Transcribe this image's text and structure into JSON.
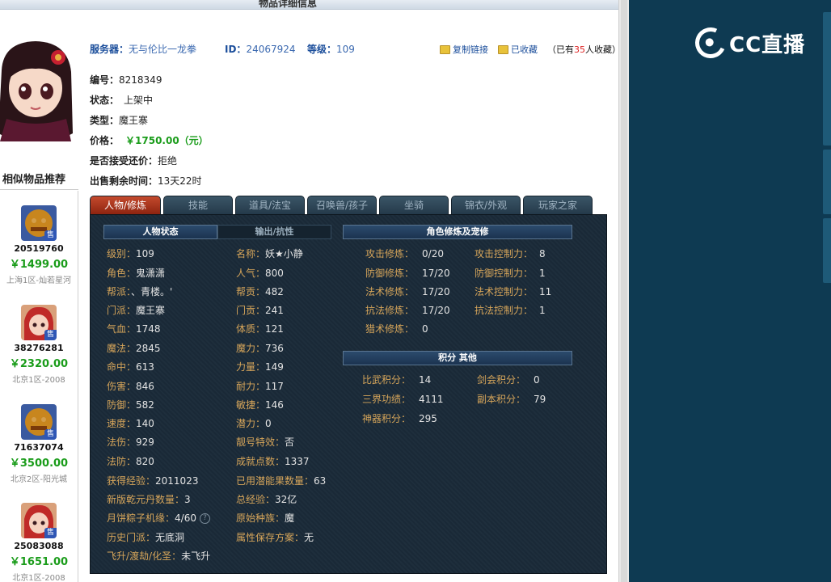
{
  "page_title": "物品详细信息",
  "header": {
    "server_label": "服务器：",
    "server_value": "无与伦比一龙拳",
    "id_label": "ID：",
    "id_value": "24067924",
    "level_label": "等级：",
    "level_value": "109",
    "copy_link": "复制链接",
    "favorited": "已收藏",
    "fav_prefix": "（已有",
    "fav_count": "35",
    "fav_suffix": "人收藏）"
  },
  "item_info": {
    "serial_label": "编号：",
    "serial_value": "8218349",
    "status_label": "状态：",
    "status_value": "上架中",
    "type_label": "类型：",
    "type_value": "魔王寨",
    "price_label": "价格：",
    "price_value": "￥1750.00（元）",
    "bargain_label": "是否接受还价：",
    "bargain_value": "拒绝",
    "remaining_label": "出售剩余时间：",
    "remaining_value": "13天22时"
  },
  "similar": {
    "title": "相似物品推荐",
    "badge": "售",
    "items": [
      {
        "id": "20519760",
        "price": "￥1499.00",
        "server": "上海1区-灿若星河"
      },
      {
        "id": "38276281",
        "price": "￥2320.00",
        "server": "北京1区-2008"
      },
      {
        "id": "71637074",
        "price": "￥3500.00",
        "server": "北京2区-阳光城"
      },
      {
        "id": "25083088",
        "price": "￥1651.00",
        "server": "北京1区-2008"
      }
    ]
  },
  "tabs": [
    "人物/修炼",
    "技能",
    "道具/法宝",
    "召唤兽/孩子",
    "坐骑",
    "锦衣/外观",
    "玩家之家"
  ],
  "panel": {
    "char_status_title": "人物状态",
    "output_title": "输出/抗性",
    "cultivation_title": "角色修炼及宠修",
    "points_title": "积分 其他",
    "left_col": [
      {
        "k": "级别：",
        "v": "109"
      },
      {
        "k": "角色：",
        "v": "鬼潇潇"
      },
      {
        "k": "帮派：",
        "v": "、青楼。'"
      },
      {
        "k": "门派：",
        "v": "魔王寨"
      },
      {
        "k": "气血：",
        "v": "1748"
      },
      {
        "k": "魔法：",
        "v": "2845"
      },
      {
        "k": "命中：",
        "v": "613"
      },
      {
        "k": "伤害：",
        "v": "846"
      },
      {
        "k": "防御：",
        "v": "582"
      },
      {
        "k": "速度：",
        "v": "140"
      },
      {
        "k": "法伤：",
        "v": "929"
      },
      {
        "k": "法防：",
        "v": "820"
      },
      {
        "k": "获得经验：",
        "v": "2011023"
      },
      {
        "k": "新版乾元丹数量：",
        "v": "3"
      },
      {
        "k": "月饼粽子机缘：",
        "v": "4/60"
      },
      {
        "k": "历史门派：",
        "v": "无底洞"
      },
      {
        "k": "飞升/渡劫/化圣：",
        "v": "未飞升"
      }
    ],
    "mid_col": [
      {
        "k": "名称：",
        "v": "妖★小静"
      },
      {
        "k": "人气：",
        "v": "800"
      },
      {
        "k": "帮贡：",
        "v": "482"
      },
      {
        "k": "门贡：",
        "v": "241"
      },
      {
        "k": "体质：",
        "v": "121"
      },
      {
        "k": "魔力：",
        "v": "736"
      },
      {
        "k": "力量：",
        "v": "149"
      },
      {
        "k": "耐力：",
        "v": "117"
      },
      {
        "k": "敏捷：",
        "v": "146"
      },
      {
        "k": "潜力：",
        "v": "0"
      },
      {
        "k": "靓号特效：",
        "v": "否"
      },
      {
        "k": "成就点数：",
        "v": "1337"
      },
      {
        "k": "已用潜能果数量：",
        "v": "63"
      },
      {
        "k": "总经验：",
        "v": "32亿"
      },
      {
        "k": "原始种族：",
        "v": "魔"
      },
      {
        "k": "属性保存方案：",
        "v": "无"
      }
    ],
    "cultivation_left": [
      {
        "k": "攻击修炼：",
        "v": "0/20"
      },
      {
        "k": "防御修炼：",
        "v": "17/20"
      },
      {
        "k": "法术修炼：",
        "v": "17/20"
      },
      {
        "k": "抗法修炼：",
        "v": "17/20"
      },
      {
        "k": "猎术修炼：",
        "v": "0"
      }
    ],
    "cultivation_right": [
      {
        "k": "攻击控制力：",
        "v": "8"
      },
      {
        "k": "防御控制力：",
        "v": "1"
      },
      {
        "k": "法术控制力：",
        "v": "11"
      },
      {
        "k": "抗法控制力：",
        "v": "1"
      }
    ],
    "points_left": [
      {
        "k": "比武积分：",
        "v": "14"
      },
      {
        "k": "三界功绩：",
        "v": "4111"
      },
      {
        "k": "神器积分：",
        "v": "295"
      }
    ],
    "points_right": [
      {
        "k": "剑会积分：",
        "v": "0"
      },
      {
        "k": "副本积分：",
        "v": "79"
      }
    ]
  },
  "stream": {
    "logo_text": "CC直播"
  },
  "colors": {
    "accent_green": "#1a9c1a",
    "tab_active": "#c44a2d",
    "panel_bg": "#1a2a38",
    "stream_bg": "#0e3a52",
    "key_gold": "#d6a55a"
  }
}
